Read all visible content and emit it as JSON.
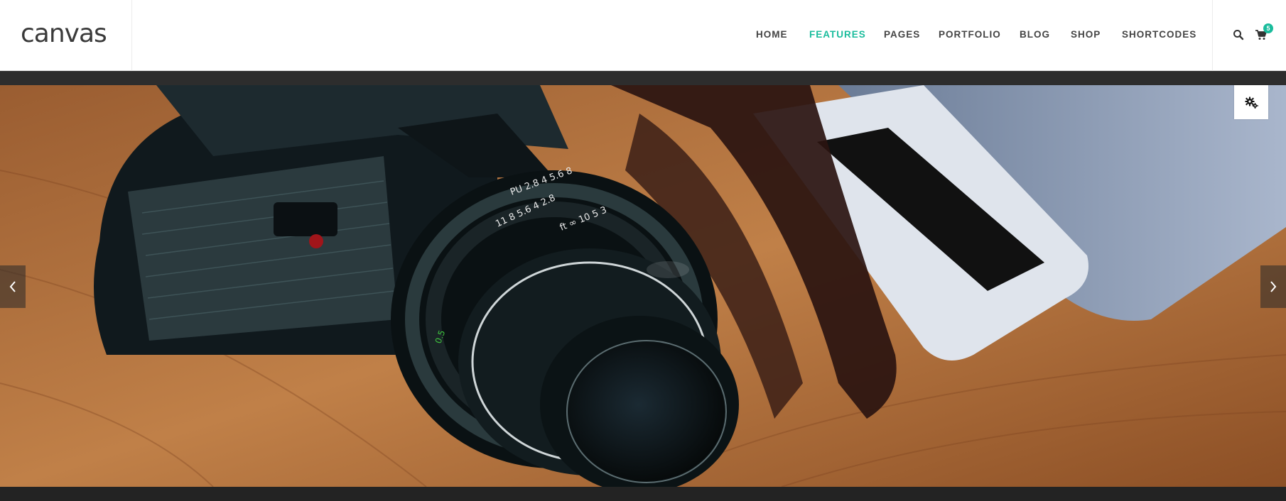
{
  "brand": {
    "logo_text": "canvas"
  },
  "nav": {
    "items": [
      {
        "label": "HOME",
        "active": false
      },
      {
        "label": "FEATURES",
        "active": true
      },
      {
        "label": "PAGES",
        "active": false
      },
      {
        "label": "PORTFOLIO",
        "active": false
      },
      {
        "label": "BLOG",
        "active": false
      },
      {
        "label": "SHOP",
        "active": false
      },
      {
        "label": "SHORTCODES",
        "active": false
      }
    ]
  },
  "header_icons": {
    "search": "search-icon",
    "cart": "cart-icon",
    "cart_count": "5"
  },
  "slider": {
    "prev": "chevron-left-icon",
    "next": "chevron-right-icon",
    "settings": "gears-icon"
  },
  "colors": {
    "accent": "#1abc9c",
    "nav_text": "#444444",
    "logo": "#3a3a3a",
    "dark_strip": "#2d2d2d"
  }
}
